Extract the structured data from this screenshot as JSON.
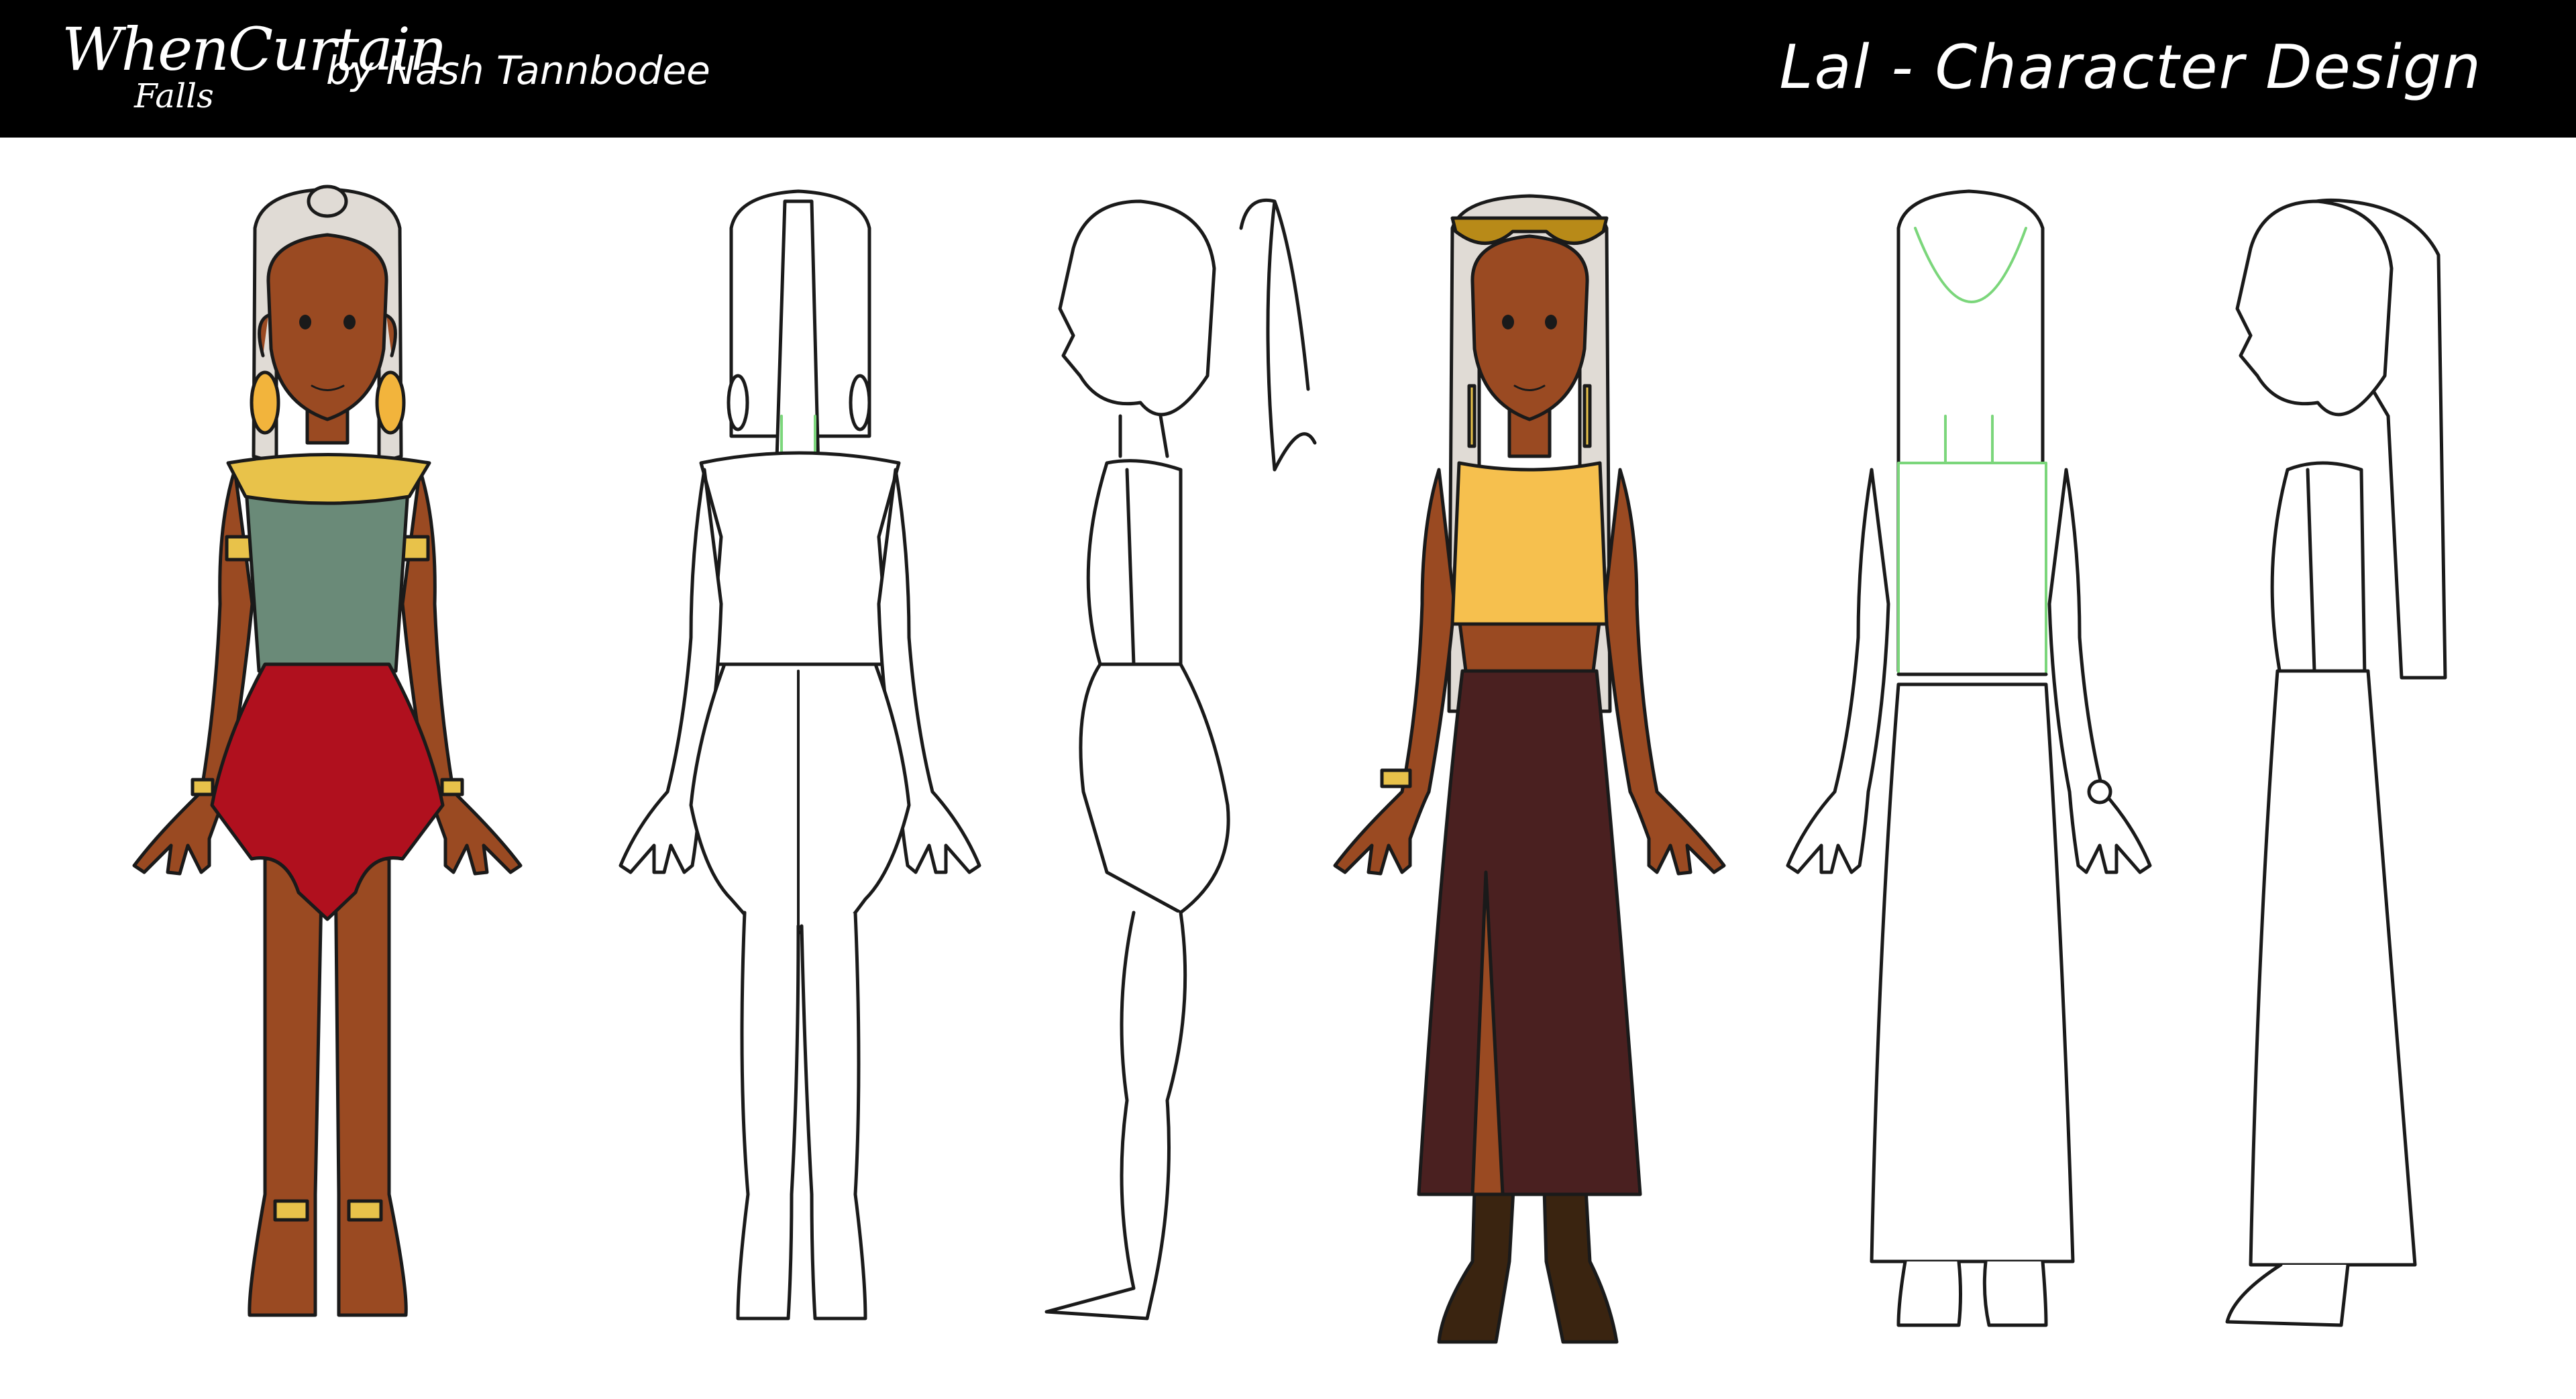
{
  "header": {
    "logo_main": "WhenCurtain",
    "logo_sub": "Falls",
    "byline": "by Nash Tannbodee",
    "title": "Lal - Character Design"
  },
  "colors": {
    "header_background": "#000000",
    "skin": "#9a4a22",
    "hair": "#e0dbd5",
    "gold": "#e8c24a",
    "earring": "#f2b43c",
    "outfit1_top": "#6a8a78",
    "outfit1_skirt": "#b0101e",
    "outfit2_top": "#f6c04e",
    "outfit2_skirt": "#4a2020",
    "boots": "#3a2410",
    "sunglasses": "#b88a18",
    "lineart": "#1a1a1a",
    "construction_lines": "#7bd67b"
  },
  "figures": [
    {
      "id": "outfit1-front-color",
      "view": "front",
      "style": "color"
    },
    {
      "id": "outfit1-back-lineart",
      "view": "back",
      "style": "lineart"
    },
    {
      "id": "outfit1-side-lineart",
      "view": "side",
      "style": "lineart"
    },
    {
      "id": "outfit2-front-color",
      "view": "front",
      "style": "color"
    },
    {
      "id": "outfit2-back-lineart",
      "view": "back",
      "style": "lineart"
    },
    {
      "id": "outfit2-side-lineart",
      "view": "side",
      "style": "lineart"
    }
  ]
}
